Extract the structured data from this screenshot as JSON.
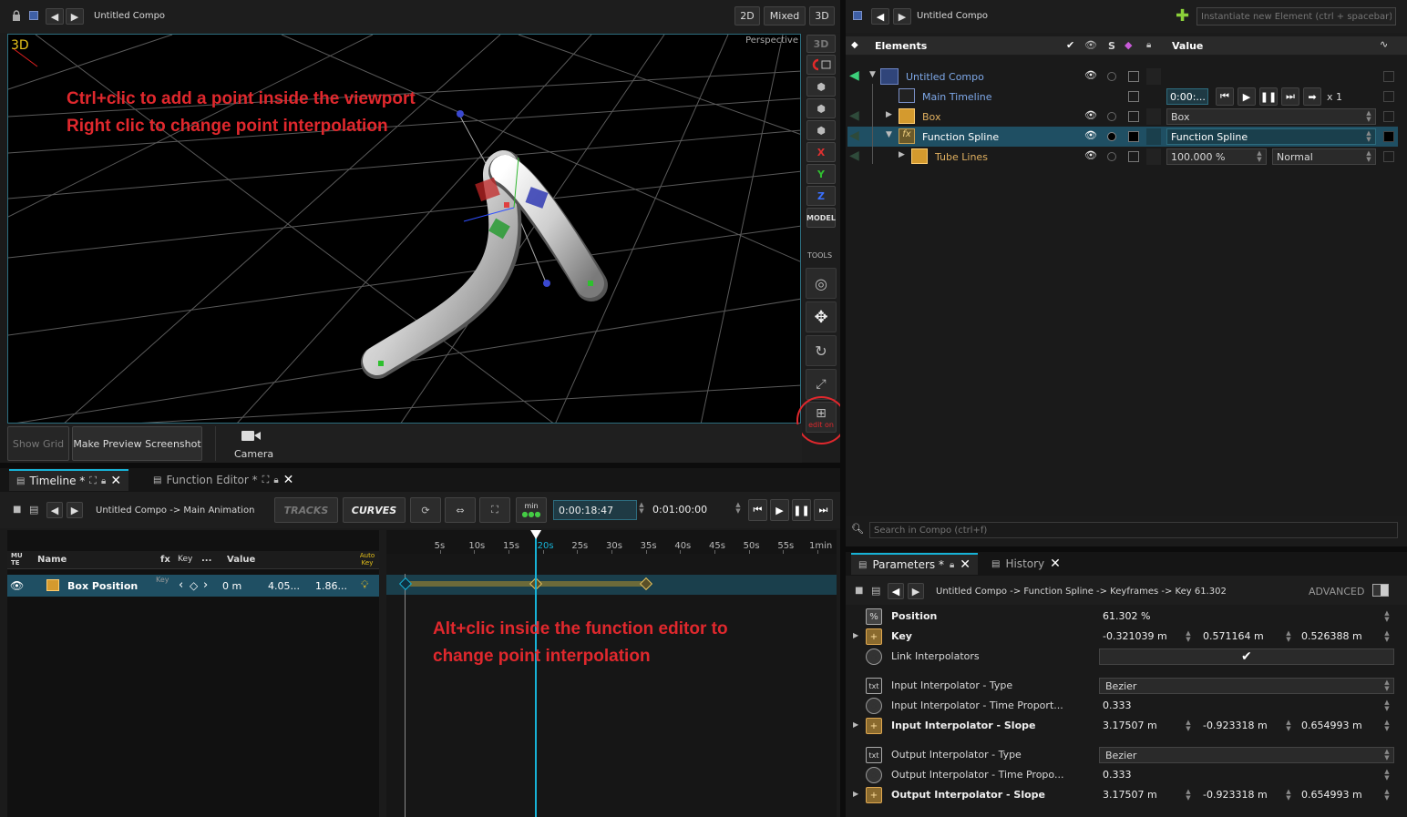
{
  "viewport": {
    "title": "Untitled Compo",
    "mode_buttons": [
      "2D",
      "Mixed",
      "3D"
    ],
    "badge": "3D",
    "projection": "Perspective",
    "annotation_line1": "Ctrl+clic to add a point inside the viewport",
    "annotation_line2": "Right clic to change point interpolation",
    "side_tools": {
      "btn_3d": "3D",
      "x": "X",
      "y": "Y",
      "z": "Z",
      "model": "MODEL",
      "tools_label": "TOOLS",
      "edit_on": "edit on"
    },
    "bottom_bar": {
      "show_grid": "Show Grid",
      "preview": "Make Preview Screenshot",
      "camera": "Camera"
    }
  },
  "timeline": {
    "tabs": [
      {
        "label": "Timeline *"
      },
      {
        "label": "Function Editor *"
      }
    ],
    "breadcrumb": "Untitled Compo -> Main Animation",
    "tracks_btn": "TRACKS",
    "curves_btn": "CURVES",
    "min_label": "min",
    "current_time": "0:00:18:47",
    "end_time": "0:01:00:00",
    "columns": {
      "mute": "MU\nTE",
      "name": "Name",
      "fx": "fx",
      "key": "Key",
      "dots": "...",
      "value": "Value",
      "autokey": "Auto Key"
    },
    "track": {
      "name": "Box Position",
      "key_label": "Key",
      "v1": "0 m",
      "v2": "4.05...",
      "v3": "1.86..."
    },
    "ruler": [
      "5s",
      "10s",
      "15s",
      "20s",
      "25s",
      "30s",
      "35s",
      "40s",
      "45s",
      "50s",
      "55s",
      "1min"
    ],
    "keyframe_times_s": [
      0,
      19,
      35
    ],
    "playhead_s": 19,
    "annotation_line1": "Alt+clic inside the function editor to",
    "annotation_line2": "change point interpolation"
  },
  "elements_panel": {
    "title": "Untitled Compo",
    "instantiate_placeholder": "Instantiate new Element (ctrl + spacebar)",
    "header": {
      "elements": "Elements",
      "s": "S",
      "value": "Value"
    },
    "rows": [
      {
        "name": "Untitled Compo"
      },
      {
        "name": "Main Timeline",
        "value": "0:00:...",
        "speed": "x 1"
      },
      {
        "name": "Box",
        "value": "Box"
      },
      {
        "name": "Function Spline",
        "value": "Function Spline"
      },
      {
        "name": "Tube Lines",
        "value": "100.000 %",
        "blend": "Normal"
      }
    ],
    "search_placeholder": "Search in Compo (ctrl+f)"
  },
  "parameters": {
    "tabs": [
      {
        "label": "Parameters *"
      },
      {
        "label": "History"
      }
    ],
    "breadcrumb": "Untitled Compo -> Function Spline -> Keyframes -> Key 61.302",
    "advanced": "ADVANCED",
    "rows": [
      {
        "icon": "%",
        "name": "Position",
        "values": [
          "61.302 %"
        ],
        "bold": true
      },
      {
        "icon": "+",
        "name": "Key",
        "values": [
          "-0.321039 m",
          "0.571164 m",
          "0.526388 m"
        ],
        "bold": true
      },
      {
        "icon": "o",
        "name": "Link Interpolators",
        "values": [
          "✔"
        ],
        "bold": false
      },
      {
        "icon": "txt",
        "name": "Input Interpolator - Type",
        "values": [
          "Bezier"
        ],
        "bold": false
      },
      {
        "icon": "o",
        "name": "Input Interpolator - Time Proport...",
        "values": [
          "0.333"
        ],
        "bold": false
      },
      {
        "icon": "+",
        "name": "Input Interpolator - Slope",
        "values": [
          "3.17507 m",
          "-0.923318 m",
          "0.654993 m"
        ],
        "bold": true
      },
      {
        "icon": "txt",
        "name": "Output Interpolator - Type",
        "values": [
          "Bezier"
        ],
        "bold": false
      },
      {
        "icon": "o",
        "name": "Output Interpolator - Time Propo...",
        "values": [
          "0.333"
        ],
        "bold": false
      },
      {
        "icon": "+",
        "name": "Output Interpolator - Slope",
        "values": [
          "3.17507 m",
          "-0.923318 m",
          "0.654993 m"
        ],
        "bold": true
      }
    ]
  },
  "colors": {
    "accent": "#17b2d6",
    "annotation": "#e0282d",
    "selected_row": "#1f4f63",
    "key_track": "#6b6a3a"
  }
}
